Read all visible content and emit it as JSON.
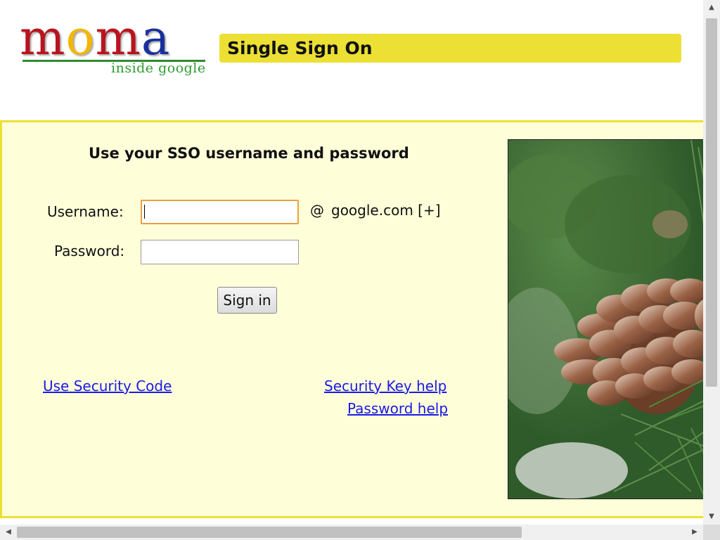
{
  "header": {
    "logo": {
      "letters": [
        "m",
        "o",
        "m",
        "a"
      ],
      "tagline": "inside google"
    },
    "title": "Single Sign On"
  },
  "login": {
    "heading": "Use your SSO username and password",
    "username_label": "Username:",
    "password_label": "Password:",
    "username_value": "",
    "password_value": "",
    "at_symbol": "@",
    "domain": "google.com [+]",
    "sign_in_label": "Sign in"
  },
  "links": {
    "security_code": "Use Security Code",
    "security_key_help": "Security Key help",
    "password_help": "Password help"
  },
  "photo": {
    "subject": "pine cone on pine branch"
  },
  "scrollbars": {
    "vertical_up_icon": "triangle-up",
    "vertical_down_icon": "triangle-down",
    "horizontal_left_icon": "triangle-left",
    "horizontal_right_icon": "triangle-right"
  },
  "colors": {
    "accent_yellow": "#ebe033",
    "panel_background": "#fefed9",
    "link_blue": "#1a1ae6",
    "focus_orange": "#e6a23c"
  }
}
